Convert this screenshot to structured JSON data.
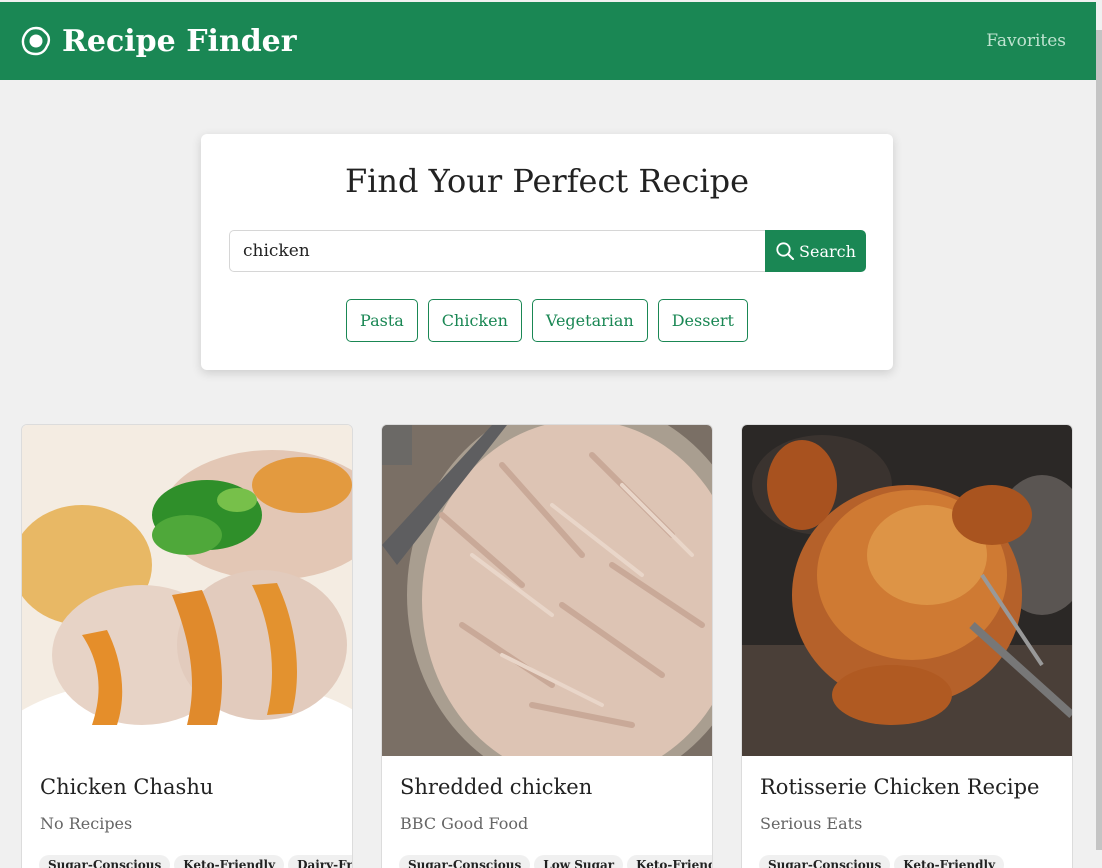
{
  "header": {
    "brand_title": "Recipe Finder",
    "favorites_label": "Favorites",
    "brand_icon": "fried-egg-icon"
  },
  "search": {
    "heading": "Find Your Perfect Recipe",
    "value": "chicken",
    "button_label": "Search",
    "quick_filters": [
      "Pasta",
      "Chicken",
      "Vegetarian",
      "Dessert"
    ]
  },
  "recipes": [
    {
      "title": "Chicken Chashu",
      "source": "No Recipes",
      "tags": [
        "Sugar-Conscious",
        "Keto-Friendly",
        "Dairy-Free"
      ]
    },
    {
      "title": "Shredded chicken",
      "source": "BBC Good Food",
      "tags": [
        "Sugar-Conscious",
        "Low Sugar",
        "Keto-Friendly"
      ]
    },
    {
      "title": "Rotisserie Chicken Recipe",
      "source": "Serious Eats",
      "tags": [
        "Sugar-Conscious",
        "Keto-Friendly"
      ]
    }
  ],
  "colors": {
    "primary": "#1a8754",
    "background": "#f0f0f0",
    "tag_background": "#f0f0f0"
  }
}
